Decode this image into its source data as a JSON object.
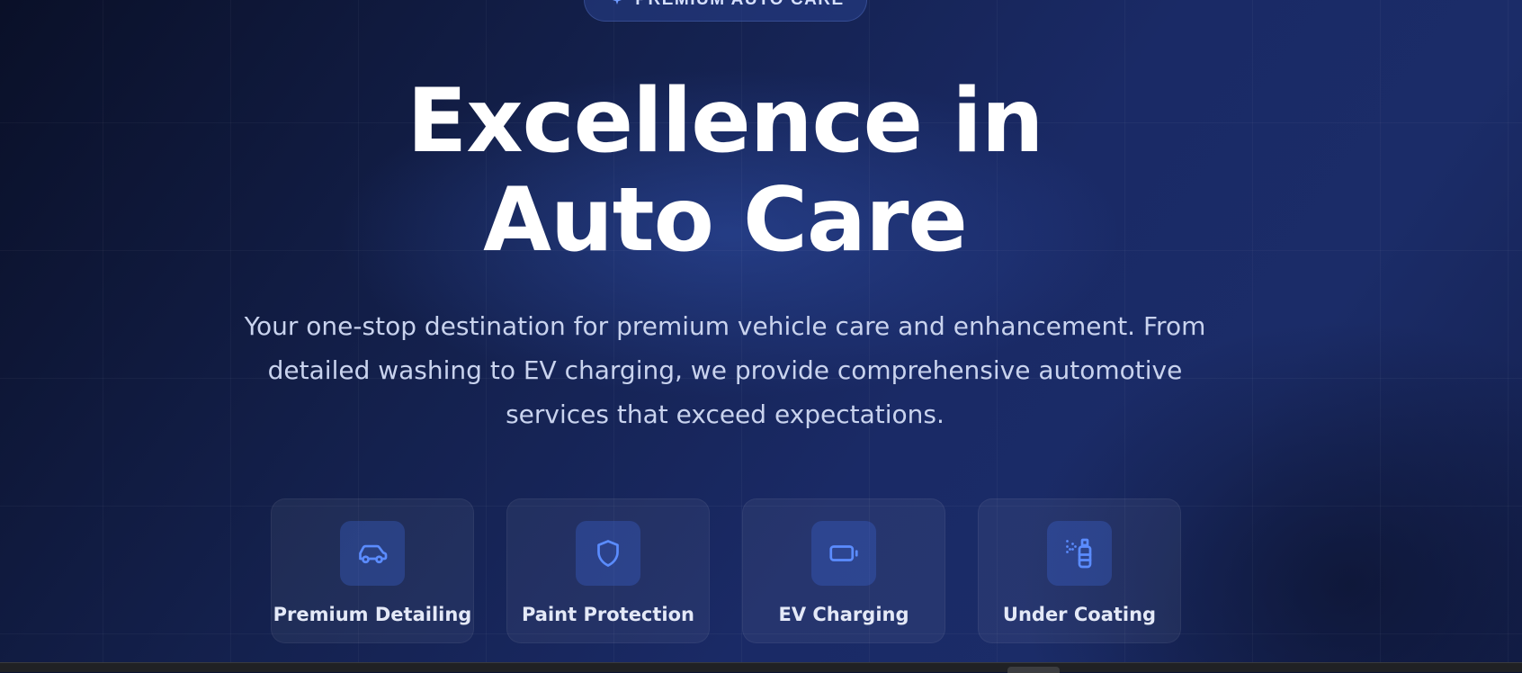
{
  "badge": {
    "label": "PREMIUM AUTO CARE",
    "icon": "sparkle-icon"
  },
  "hero": {
    "title_line1": "Excellence in",
    "title_line2": "Auto Care",
    "subtitle": "Your one-stop destination for premium vehicle care and enhancement. From detailed washing to EV charging, we provide comprehensive automotive services that exceed expectations."
  },
  "services": [
    {
      "label": "Premium Detailing",
      "icon": "car-icon"
    },
    {
      "label": "Paint Protection",
      "icon": "shield-icon"
    },
    {
      "label": "EV Charging",
      "icon": "battery-icon"
    },
    {
      "label": "Under Coating",
      "icon": "spray-can-icon"
    }
  ],
  "colors": {
    "accent": "#5b8cff",
    "background": "#14214e",
    "text": "#ffffff"
  }
}
